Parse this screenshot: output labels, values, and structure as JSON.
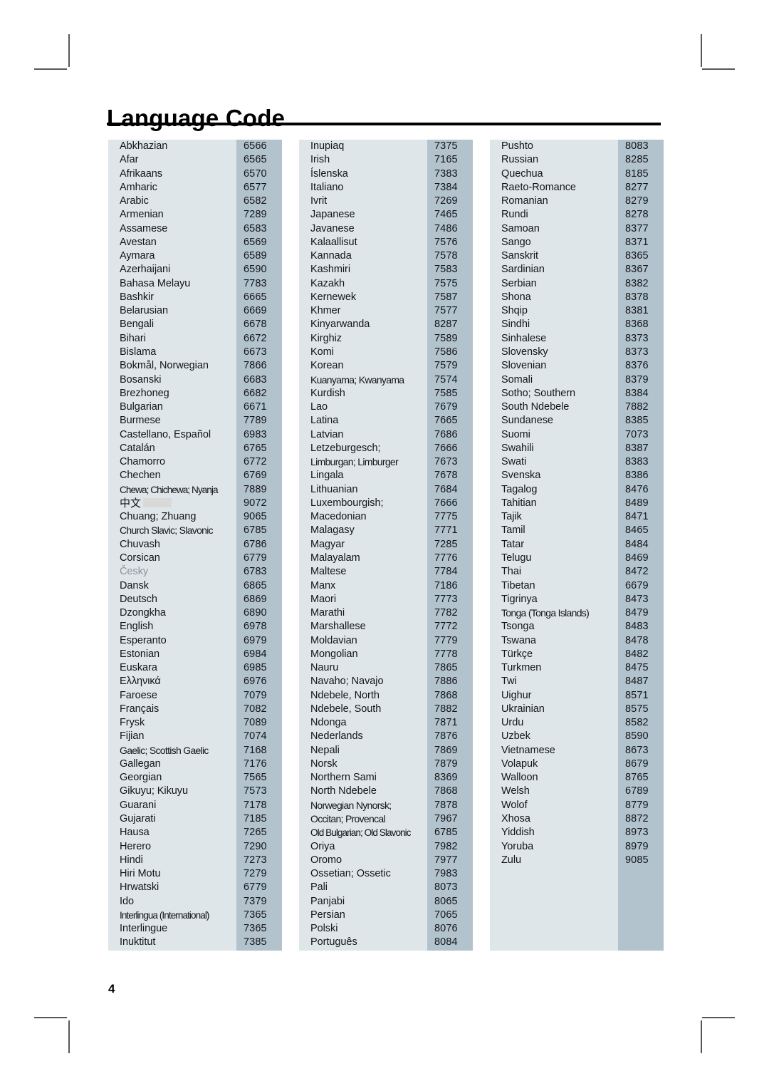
{
  "page": {
    "title": "Language Code",
    "folio": "4",
    "colors": {
      "name_cell_bg": "#dfe6ea",
      "code_cell_bg": "#b3c3cd",
      "text": "#111418",
      "dim_text": "#8d9196",
      "rule": "#000000",
      "crop_mark": "#58585a",
      "redaction": "#d9d9d9"
    }
  },
  "columns": [
    {
      "id": "column-1",
      "rows": [
        {
          "lang": "Abkhazian",
          "code": "6566"
        },
        {
          "lang": "Afar",
          "code": "6565"
        },
        {
          "lang": "Afrikaans",
          "code": "6570"
        },
        {
          "lang": "Amharic",
          "code": "6577"
        },
        {
          "lang": "Arabic",
          "code": "6582"
        },
        {
          "lang": "Armenian",
          "code": "7289"
        },
        {
          "lang": "Assamese",
          "code": "6583"
        },
        {
          "lang": "Avestan",
          "code": "6569"
        },
        {
          "lang": "Aymara",
          "code": "6589"
        },
        {
          "lang": "Azerhaijani",
          "code": "6590"
        },
        {
          "lang": "Bahasa Melayu",
          "code": "7783"
        },
        {
          "lang": "Bashkir",
          "code": "6665"
        },
        {
          "lang": "Belarusian",
          "code": "6669"
        },
        {
          "lang": "Bengali",
          "code": "6678"
        },
        {
          "lang": "Bihari",
          "code": "6672"
        },
        {
          "lang": "Bislama",
          "code": "6673"
        },
        {
          "lang": "Bokmål, Norwegian",
          "code": "7866"
        },
        {
          "lang": "Bosanski",
          "code": "6683"
        },
        {
          "lang": "Brezhoneg",
          "code": "6682"
        },
        {
          "lang": "Bulgarian",
          "code": "6671"
        },
        {
          "lang": "Burmese",
          "code": "7789"
        },
        {
          "lang": "Castellano, Español",
          "code": "6983"
        },
        {
          "lang": "Catalán",
          "code": "6765"
        },
        {
          "lang": "Chamorro",
          "code": "6772"
        },
        {
          "lang": "Chechen",
          "code": "6769"
        },
        {
          "lang": "Chewa; Chichewa; Nyanja",
          "code": "7889",
          "fit": "tighter"
        },
        {
          "lang": "中文",
          "code": "9072",
          "style": "cjk",
          "redacted": true
        },
        {
          "lang": "Chuang; Zhuang",
          "code": "9065"
        },
        {
          "lang": "Church Slavic; Slavonic",
          "code": "6785",
          "fit": "tight"
        },
        {
          "lang": "Chuvash",
          "code": "6786"
        },
        {
          "lang": "Corsican",
          "code": "6779"
        },
        {
          "lang": "Česky",
          "code": "6783",
          "style": "dim"
        },
        {
          "lang": "Dansk",
          "code": "6865"
        },
        {
          "lang": "Deutsch",
          "code": "6869"
        },
        {
          "lang": "Dzongkha",
          "code": "6890"
        },
        {
          "lang": "English",
          "code": "6978"
        },
        {
          "lang": "Esperanto",
          "code": "6979"
        },
        {
          "lang": "Estonian",
          "code": "6984"
        },
        {
          "lang": "Euskara",
          "code": "6985"
        },
        {
          "lang": "Ελληνικά",
          "code": "6976"
        },
        {
          "lang": "Faroese",
          "code": "7079"
        },
        {
          "lang": "Français",
          "code": "7082"
        },
        {
          "lang": "Frysk",
          "code": "7089"
        },
        {
          "lang": "Fijian",
          "code": "7074"
        },
        {
          "lang": "Gaelic; Scottish Gaelic",
          "code": "7168",
          "fit": "tight"
        },
        {
          "lang": "Gallegan",
          "code": "7176"
        },
        {
          "lang": "Georgian",
          "code": "7565"
        },
        {
          "lang": "Gikuyu; Kikuyu",
          "code": "7573"
        },
        {
          "lang": "Guarani",
          "code": "7178"
        },
        {
          "lang": "Gujarati",
          "code": "7185"
        },
        {
          "lang": "Hausa",
          "code": "7265"
        },
        {
          "lang": "Herero",
          "code": "7290"
        },
        {
          "lang": "Hindi",
          "code": "7273"
        },
        {
          "lang": "Hiri Motu",
          "code": "7279"
        },
        {
          "lang": "Hrwatski",
          "code": "6779"
        },
        {
          "lang": "Ido",
          "code": "7379"
        },
        {
          "lang": "Interlingua (International)",
          "code": "7365",
          "fit": "tighter"
        },
        {
          "lang": "Interlingue",
          "code": "7365"
        },
        {
          "lang": "Inuktitut",
          "code": "7385"
        }
      ]
    },
    {
      "id": "column-2",
      "rows": [
        {
          "lang": "Inupiaq",
          "code": "7375"
        },
        {
          "lang": "Irish",
          "code": "7165"
        },
        {
          "lang": "Íslenska",
          "code": "7383"
        },
        {
          "lang": "Italiano",
          "code": "7384"
        },
        {
          "lang": "Ivrit",
          "code": "7269"
        },
        {
          "lang": "Japanese",
          "code": "7465"
        },
        {
          "lang": "Javanese",
          "code": "7486"
        },
        {
          "lang": "Kalaallisut",
          "code": "7576"
        },
        {
          "lang": "Kannada",
          "code": "7578"
        },
        {
          "lang": "Kashmiri",
          "code": "7583"
        },
        {
          "lang": "Kazakh",
          "code": "7575"
        },
        {
          "lang": "Kernewek",
          "code": "7587"
        },
        {
          "lang": "Khmer",
          "code": "7577"
        },
        {
          "lang": "Kinyarwanda",
          "code": "8287"
        },
        {
          "lang": "Kirghiz",
          "code": "7589"
        },
        {
          "lang": "Komi",
          "code": "7586"
        },
        {
          "lang": "Korean",
          "code": "7579"
        },
        {
          "lang": "Kuanyama; Kwanyama",
          "code": "7574",
          "fit": "tight"
        },
        {
          "lang": "Kurdish",
          "code": "7585"
        },
        {
          "lang": "Lao",
          "code": "7679"
        },
        {
          "lang": "Latina",
          "code": "7665"
        },
        {
          "lang": "Latvian",
          "code": "7686"
        },
        {
          "lang": "Letzeburgesch;",
          "code": "7666"
        },
        {
          "lang": "Limburgan; Limburger",
          "code": "7673",
          "fit": "tight"
        },
        {
          "lang": "Lingala",
          "code": "7678"
        },
        {
          "lang": "Lithuanian",
          "code": "7684"
        },
        {
          "lang": "Luxembourgish;",
          "code": "7666"
        },
        {
          "lang": "Macedonian",
          "code": "7775"
        },
        {
          "lang": "Malagasy",
          "code": "7771"
        },
        {
          "lang": "Magyar",
          "code": "7285"
        },
        {
          "lang": "Malayalam",
          "code": "7776"
        },
        {
          "lang": "Maltese",
          "code": "7784"
        },
        {
          "lang": "Manx",
          "code": "7186"
        },
        {
          "lang": "Maori",
          "code": "7773"
        },
        {
          "lang": "Marathi",
          "code": "7782"
        },
        {
          "lang": "Marshallese",
          "code": "7772"
        },
        {
          "lang": "Moldavian",
          "code": "7779"
        },
        {
          "lang": "Mongolian",
          "code": "7778"
        },
        {
          "lang": "Nauru",
          "code": "7865"
        },
        {
          "lang": "Navaho; Navajo",
          "code": "7886"
        },
        {
          "lang": "Ndebele, North",
          "code": "7868"
        },
        {
          "lang": "Ndebele, South",
          "code": "7882"
        },
        {
          "lang": "Ndonga",
          "code": "7871"
        },
        {
          "lang": "Nederlands",
          "code": "7876"
        },
        {
          "lang": "Nepali",
          "code": "7869"
        },
        {
          "lang": "Norsk",
          "code": "7879"
        },
        {
          "lang": "Northern Sami",
          "code": "8369"
        },
        {
          "lang": "North Ndebele",
          "code": "7868"
        },
        {
          "lang": "Norwegian Nynorsk;",
          "code": "7878",
          "fit": "tight"
        },
        {
          "lang": "Occitan; Provencal",
          "code": "7967",
          "fit": "tight"
        },
        {
          "lang": "Old Bulgarian; Old Slavonic",
          "code": "6785",
          "fit": "tighter"
        },
        {
          "lang": "Oriya",
          "code": "7982"
        },
        {
          "lang": "Oromo",
          "code": "7977"
        },
        {
          "lang": "Ossetian; Ossetic",
          "code": "7983"
        },
        {
          "lang": "Pali",
          "code": "8073"
        },
        {
          "lang": "Panjabi",
          "code": "8065"
        },
        {
          "lang": "Persian",
          "code": "7065"
        },
        {
          "lang": "Polski",
          "code": "8076"
        },
        {
          "lang": "Português",
          "code": "8084"
        }
      ]
    },
    {
      "id": "column-3",
      "rows": [
        {
          "lang": "Pushto",
          "code": "8083"
        },
        {
          "lang": "Russian",
          "code": "8285"
        },
        {
          "lang": "Quechua",
          "code": "8185"
        },
        {
          "lang": "Raeto-Romance",
          "code": "8277"
        },
        {
          "lang": "Romanian",
          "code": "8279"
        },
        {
          "lang": "Rundi",
          "code": "8278"
        },
        {
          "lang": "Samoan",
          "code": "8377"
        },
        {
          "lang": "Sango",
          "code": "8371"
        },
        {
          "lang": "Sanskrit",
          "code": "8365"
        },
        {
          "lang": "Sardinian",
          "code": "8367"
        },
        {
          "lang": "Serbian",
          "code": "8382"
        },
        {
          "lang": "Shona",
          "code": "8378"
        },
        {
          "lang": "Shqip",
          "code": "8381"
        },
        {
          "lang": "Sindhi",
          "code": "8368"
        },
        {
          "lang": "Sinhalese",
          "code": "8373"
        },
        {
          "lang": "Slovensky",
          "code": "8373"
        },
        {
          "lang": "Slovenian",
          "code": "8376"
        },
        {
          "lang": "Somali",
          "code": "8379"
        },
        {
          "lang": "Sotho; Southern",
          "code": "8384"
        },
        {
          "lang": "South Ndebele",
          "code": "7882"
        },
        {
          "lang": "Sundanese",
          "code": "8385"
        },
        {
          "lang": "Suomi",
          "code": "7073"
        },
        {
          "lang": "Swahili",
          "code": "8387"
        },
        {
          "lang": "Swati",
          "code": "8383"
        },
        {
          "lang": "Svenska",
          "code": "8386"
        },
        {
          "lang": "Tagalog",
          "code": "8476"
        },
        {
          "lang": "Tahitian",
          "code": "8489"
        },
        {
          "lang": "Tajik",
          "code": "8471"
        },
        {
          "lang": "Tamil",
          "code": "8465"
        },
        {
          "lang": "Tatar",
          "code": "8484"
        },
        {
          "lang": "Telugu",
          "code": "8469"
        },
        {
          "lang": "Thai",
          "code": "8472"
        },
        {
          "lang": "Tibetan",
          "code": "6679"
        },
        {
          "lang": "Tigrinya",
          "code": "8473"
        },
        {
          "lang": "Tonga (Tonga Islands)",
          "code": "8479",
          "fit": "tight"
        },
        {
          "lang": "Tsonga",
          "code": "8483"
        },
        {
          "lang": "Tswana",
          "code": "8478"
        },
        {
          "lang": "Türkçe",
          "code": "8482"
        },
        {
          "lang": "Turkmen",
          "code": "8475"
        },
        {
          "lang": "Twi",
          "code": "8487"
        },
        {
          "lang": "Uighur",
          "code": "8571"
        },
        {
          "lang": "Ukrainian",
          "code": "8575"
        },
        {
          "lang": "Urdu",
          "code": "8582"
        },
        {
          "lang": "Uzbek",
          "code": "8590"
        },
        {
          "lang": "Vietnamese",
          "code": "8673"
        },
        {
          "lang": "Volapuk",
          "code": "8679"
        },
        {
          "lang": "Walloon",
          "code": "8765"
        },
        {
          "lang": "Welsh",
          "code": "6789"
        },
        {
          "lang": "Wolof",
          "code": "8779"
        },
        {
          "lang": "Xhosa",
          "code": "8872"
        },
        {
          "lang": "Yiddish",
          "code": "8973"
        },
        {
          "lang": "Yoruba",
          "code": "8979"
        },
        {
          "lang": "Zulu",
          "code": "9085"
        }
      ]
    }
  ]
}
